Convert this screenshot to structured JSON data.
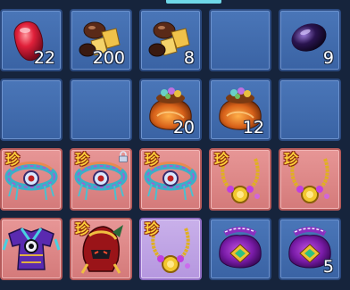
{
  "inventory": {
    "slots": [
      {
        "item": "red-gem",
        "qty": "22",
        "rare": false
      },
      {
        "item": "gold-nuggets",
        "qty": "200",
        "rare": false
      },
      {
        "item": "gold-nuggets",
        "qty": "8",
        "rare": false
      },
      {
        "item": "empty",
        "qty": "",
        "rare": false
      },
      {
        "item": "dark-purple-gem",
        "qty": "9",
        "rare": false
      },
      {
        "item": "empty",
        "qty": "",
        "rare": false
      },
      {
        "item": "empty",
        "qty": "",
        "rare": false
      },
      {
        "item": "treasure-pouch",
        "qty": "20",
        "rare": false
      },
      {
        "item": "treasure-pouch",
        "qty": "12",
        "rare": false
      },
      {
        "item": "empty",
        "qty": "",
        "rare": false
      },
      {
        "item": "jeweled-belt",
        "qty": "",
        "rare": true,
        "rare_label": "珍"
      },
      {
        "item": "jeweled-belt",
        "qty": "",
        "rare": true,
        "rare_label": "珍",
        "locked": true
      },
      {
        "item": "jeweled-belt",
        "qty": "",
        "rare": true,
        "rare_label": "珍"
      },
      {
        "item": "gold-necklace",
        "qty": "",
        "rare": true,
        "rare_label": "珍"
      },
      {
        "item": "gold-necklace",
        "qty": "",
        "rare": true,
        "rare_label": "珍"
      },
      {
        "item": "ornate-armor",
        "qty": "",
        "rare": false
      },
      {
        "item": "dragon-helmet",
        "qty": "",
        "rare": true,
        "rare_label": "珍"
      },
      {
        "item": "gold-necklace",
        "qty": "",
        "rare": true,
        "rare_label": "珍"
      },
      {
        "item": "purple-pouch",
        "qty": "",
        "rare": false
      },
      {
        "item": "purple-pouch",
        "qty": "5",
        "rare": false
      }
    ]
  },
  "colors": {
    "background": "#16243c",
    "slot_empty": "#4a76b8",
    "slot_rare": "#d47a7a",
    "slot_epic": "#b597df",
    "rare_tag": "#ffd23a"
  }
}
